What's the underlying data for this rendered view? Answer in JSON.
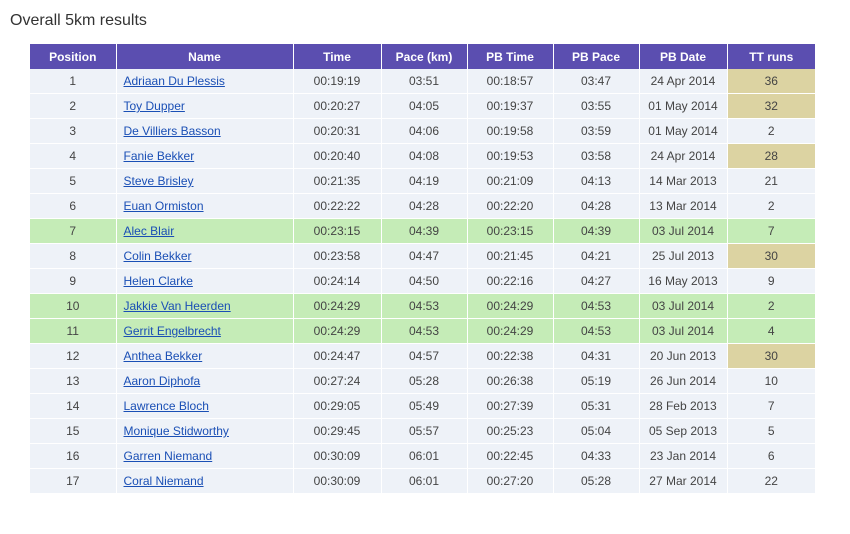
{
  "page": {
    "title": "Overall 5km results"
  },
  "table": {
    "headers": [
      "Position",
      "Name",
      "Time",
      "Pace (km)",
      "PB Time",
      "PB Pace",
      "PB Date",
      "TT runs"
    ],
    "row_highlight_color": "#c5ecb7",
    "tt_highlight_color": "#dcd3a2",
    "header_color": "#5b4eb0",
    "rows": [
      {
        "position": "1",
        "name": "Adriaan Du Plessis",
        "time": "00:19:19",
        "pace": "03:51",
        "pb_time": "00:18:57",
        "pb_pace": "03:47",
        "pb_date": "24 Apr 2014",
        "tt_runs": "36",
        "pb_today": false,
        "tt_high": true
      },
      {
        "position": "2",
        "name": "Toy Dupper",
        "time": "00:20:27",
        "pace": "04:05",
        "pb_time": "00:19:37",
        "pb_pace": "03:55",
        "pb_date": "01 May 2014",
        "tt_runs": "32",
        "pb_today": false,
        "tt_high": true
      },
      {
        "position": "3",
        "name": "De Villiers Basson",
        "time": "00:20:31",
        "pace": "04:06",
        "pb_time": "00:19:58",
        "pb_pace": "03:59",
        "pb_date": "01 May 2014",
        "tt_runs": "2",
        "pb_today": false,
        "tt_high": false
      },
      {
        "position": "4",
        "name": "Fanie Bekker",
        "time": "00:20:40",
        "pace": "04:08",
        "pb_time": "00:19:53",
        "pb_pace": "03:58",
        "pb_date": "24 Apr 2014",
        "tt_runs": "28",
        "pb_today": false,
        "tt_high": true
      },
      {
        "position": "5",
        "name": "Steve Brisley",
        "time": "00:21:35",
        "pace": "04:19",
        "pb_time": "00:21:09",
        "pb_pace": "04:13",
        "pb_date": "14 Mar 2013",
        "tt_runs": "21",
        "pb_today": false,
        "tt_high": false
      },
      {
        "position": "6",
        "name": "Euan Ormiston",
        "time": "00:22:22",
        "pace": "04:28",
        "pb_time": "00:22:20",
        "pb_pace": "04:28",
        "pb_date": "13 Mar 2014",
        "tt_runs": "2",
        "pb_today": false,
        "tt_high": false
      },
      {
        "position": "7",
        "name": "Alec Blair",
        "time": "00:23:15",
        "pace": "04:39",
        "pb_time": "00:23:15",
        "pb_pace": "04:39",
        "pb_date": "03 Jul 2014",
        "tt_runs": "7",
        "pb_today": true,
        "tt_high": false
      },
      {
        "position": "8",
        "name": "Colin Bekker",
        "time": "00:23:58",
        "pace": "04:47",
        "pb_time": "00:21:45",
        "pb_pace": "04:21",
        "pb_date": "25 Jul 2013",
        "tt_runs": "30",
        "pb_today": false,
        "tt_high": true
      },
      {
        "position": "9",
        "name": "Helen Clarke",
        "time": "00:24:14",
        "pace": "04:50",
        "pb_time": "00:22:16",
        "pb_pace": "04:27",
        "pb_date": "16 May 2013",
        "tt_runs": "9",
        "pb_today": false,
        "tt_high": false
      },
      {
        "position": "10",
        "name": "Jakkie Van Heerden",
        "time": "00:24:29",
        "pace": "04:53",
        "pb_time": "00:24:29",
        "pb_pace": "04:53",
        "pb_date": "03 Jul 2014",
        "tt_runs": "2",
        "pb_today": true,
        "tt_high": false
      },
      {
        "position": "11",
        "name": "Gerrit Engelbrecht",
        "time": "00:24:29",
        "pace": "04:53",
        "pb_time": "00:24:29",
        "pb_pace": "04:53",
        "pb_date": "03 Jul 2014",
        "tt_runs": "4",
        "pb_today": true,
        "tt_high": false
      },
      {
        "position": "12",
        "name": "Anthea Bekker",
        "time": "00:24:47",
        "pace": "04:57",
        "pb_time": "00:22:38",
        "pb_pace": "04:31",
        "pb_date": "20 Jun 2013",
        "tt_runs": "30",
        "pb_today": false,
        "tt_high": true
      },
      {
        "position": "13",
        "name": "Aaron Diphofa",
        "time": "00:27:24",
        "pace": "05:28",
        "pb_time": "00:26:38",
        "pb_pace": "05:19",
        "pb_date": "26 Jun 2014",
        "tt_runs": "10",
        "pb_today": false,
        "tt_high": false
      },
      {
        "position": "14",
        "name": "Lawrence Bloch",
        "time": "00:29:05",
        "pace": "05:49",
        "pb_time": "00:27:39",
        "pb_pace": "05:31",
        "pb_date": "28 Feb 2013",
        "tt_runs": "7",
        "pb_today": false,
        "tt_high": false
      },
      {
        "position": "15",
        "name": "Monique Stidworthy",
        "time": "00:29:45",
        "pace": "05:57",
        "pb_time": "00:25:23",
        "pb_pace": "05:04",
        "pb_date": "05 Sep 2013",
        "tt_runs": "5",
        "pb_today": false,
        "tt_high": false
      },
      {
        "position": "16",
        "name": "Garren Niemand",
        "time": "00:30:09",
        "pace": "06:01",
        "pb_time": "00:22:45",
        "pb_pace": "04:33",
        "pb_date": "23 Jan 2014",
        "tt_runs": "6",
        "pb_today": false,
        "tt_high": false
      },
      {
        "position": "17",
        "name": "Coral Niemand",
        "time": "00:30:09",
        "pace": "06:01",
        "pb_time": "00:27:20",
        "pb_pace": "05:28",
        "pb_date": "27 Mar 2014",
        "tt_runs": "22",
        "pb_today": false,
        "tt_high": false
      }
    ]
  }
}
